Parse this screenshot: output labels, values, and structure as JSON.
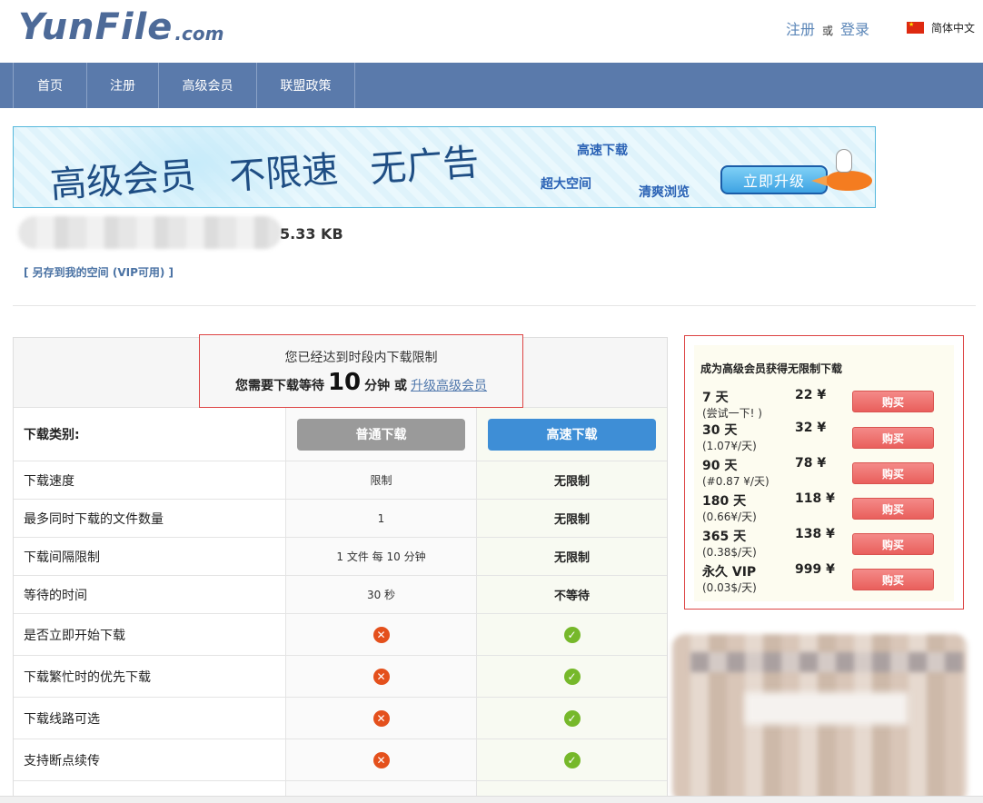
{
  "header": {
    "logo_main": "YunFile",
    "logo_suffix": ".com",
    "register": "注册",
    "or": "或",
    "login": "登录",
    "language": "简体中文"
  },
  "nav": {
    "items": [
      {
        "label": "首页"
      },
      {
        "label": "注册"
      },
      {
        "label": "高级会员"
      },
      {
        "label": "联盟政策"
      }
    ]
  },
  "banner": {
    "text1": "高级会员",
    "text2": "不限速",
    "text3": "无广告",
    "feature1": "高速下载",
    "feature2": "超大空间",
    "feature3": "清爽浏览",
    "cta": "立即升级"
  },
  "file": {
    "size": "5.33 KB",
    "save_link": "[ 另存到我的空间 (VIP可用) ]"
  },
  "notice": {
    "line1": "您已经达到时段内下载限制",
    "line2_prefix": "您需要下载等待",
    "wait_minutes": "10",
    "line2_unit": "分钟 或",
    "upgrade_link": "升级高级会员"
  },
  "comparison": {
    "category_label": "下载类别:",
    "normal_button": "普通下载",
    "fast_button": "高速下载",
    "rows": [
      {
        "label": "下载速度",
        "normal": "限制",
        "fast": "无限制"
      },
      {
        "label": "最多同时下载的文件数量",
        "normal": "1",
        "fast": "无限制"
      },
      {
        "label": "下载间隔限制",
        "normal": "1 文件 每 10 分钟",
        "fast": "无限制"
      },
      {
        "label": "等待的时间",
        "normal": "30 秒",
        "fast": "不等待"
      },
      {
        "label": "是否立即开始下载",
        "normal_icon": "x-icon",
        "fast_icon": "check-icon"
      },
      {
        "label": "下载繁忙时的优先下载",
        "normal_icon": "x-icon",
        "fast_icon": "check-icon"
      },
      {
        "label": "下载线路可选",
        "normal_icon": "x-icon",
        "fast_icon": "check-icon"
      },
      {
        "label": "支持断点续传",
        "normal_icon": "x-icon",
        "fast_icon": "check-icon"
      }
    ]
  },
  "pricing": {
    "title": "成为高级会员获得无限制下载",
    "buy_label": "购买",
    "plans": [
      {
        "duration": "7 天",
        "sub": "(尝试一下! )",
        "price": "22 ¥"
      },
      {
        "duration": "30 天",
        "sub": "(1.07¥/天)",
        "price": "32 ¥"
      },
      {
        "duration": "90 天",
        "sub": "(#0.87 ¥/天)",
        "price": "78 ¥"
      },
      {
        "duration": "180 天",
        "sub": "(0.66¥/天)",
        "price": "118 ¥"
      },
      {
        "duration": "365 天",
        "sub": "(0.38$/天)",
        "price": "138 ¥"
      },
      {
        "duration": "永久 VIP",
        "sub": "(0.03$/天)",
        "price": "999 ¥"
      }
    ]
  },
  "colors": {
    "nav_bg": "#5a7aab",
    "link": "#5b86b8",
    "fast_button": "#3e8ed6",
    "normal_button": "#9a9a9a",
    "buy_button": "#e95f5c",
    "x_icon": "#e4501c",
    "check_icon": "#76b82a"
  }
}
